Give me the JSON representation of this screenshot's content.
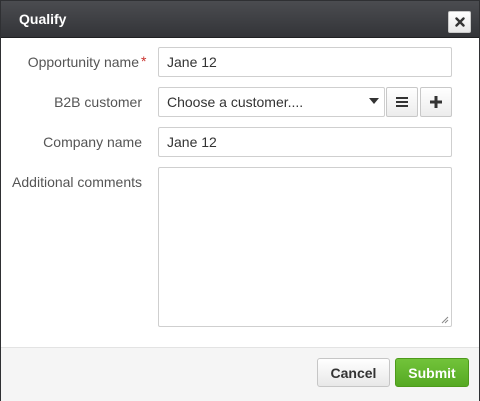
{
  "dialog": {
    "title": "Qualify",
    "close_icon": "close-x-icon"
  },
  "form": {
    "opportunity_name": {
      "label": "Opportunity name",
      "required_mark": "*",
      "value": "Jane 12"
    },
    "b2b_customer": {
      "label": "B2B customer",
      "selected": "Choose a customer....",
      "list_icon": "list-icon",
      "add_icon": "plus-icon"
    },
    "company_name": {
      "label": "Company name",
      "value": "Jane 12"
    },
    "additional_comments": {
      "label": "Additional comments",
      "value": ""
    }
  },
  "footer": {
    "cancel_label": "Cancel",
    "submit_label": "Submit"
  },
  "colors": {
    "title_bar": "#3d3e42",
    "submit": "#5fb52c",
    "required": "#c9302c"
  }
}
